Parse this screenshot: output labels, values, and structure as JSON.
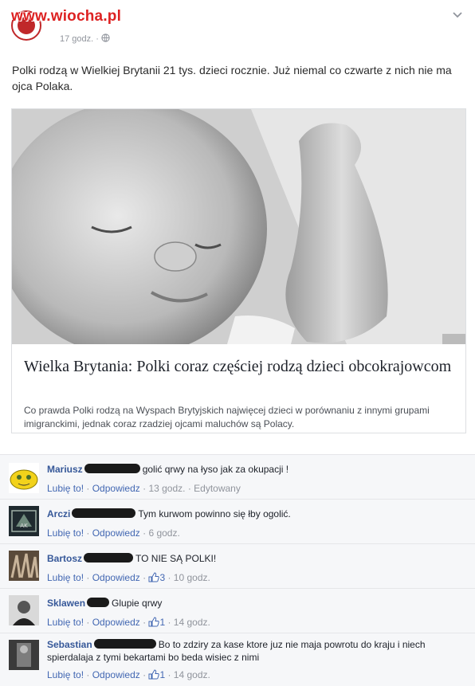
{
  "watermark": "www.wiocha.pl",
  "post": {
    "time": "17 godz.",
    "privacy_icon": "globe-icon",
    "menu_icon": "chevron-down-icon",
    "text": "Polki rodzą w Wielkiej Brytanii 21 tys. dzieci rocznie. Już niemal co czwarte z nich nie ma ojca Polaka."
  },
  "link": {
    "title": "Wielka Brytania: Polki coraz częściej rodzą dzieci obcokrajowcom",
    "description": "Co prawda Polki rodzą na Wyspach Brytyjskich najwięcej dzieci w porównaniu z innymi grupami imigranckimi, jednak coraz rzadziej ojcami maluchów są Polacy."
  },
  "comments": [
    {
      "name": "Mariusz",
      "text": "golić qrwy na łyso jak za okupacji !",
      "like": "Lubię to!",
      "reply": "Odpowiedz",
      "likes": "",
      "time": "13 godz.",
      "edited": "Edytowany"
    },
    {
      "name": "Arczi",
      "text": "Tym kurwom powinno się łby ogolić.",
      "like": "Lubię to!",
      "reply": "Odpowiedz",
      "likes": "",
      "time": "6 godz.",
      "edited": ""
    },
    {
      "name": "Bartosz",
      "text": "TO NIE SĄ POLKI!",
      "like": "Lubię to!",
      "reply": "Odpowiedz",
      "likes": "3",
      "time": "10 godz.",
      "edited": ""
    },
    {
      "name": "Sklawen",
      "text": "Glupie qrwy",
      "like": "Lubię to!",
      "reply": "Odpowiedz",
      "likes": "1",
      "time": "14 godz.",
      "edited": ""
    },
    {
      "name": "Sebastian",
      "text": "Bo to zdziry za kase ktore juz nie maja powrotu do kraju i niech spierdalaja z tymi bekartami bo beda wisiec z nimi",
      "like": "Lubię to!",
      "reply": "Odpowiedz",
      "likes": "1",
      "time": "14 godz.",
      "edited": ""
    }
  ]
}
